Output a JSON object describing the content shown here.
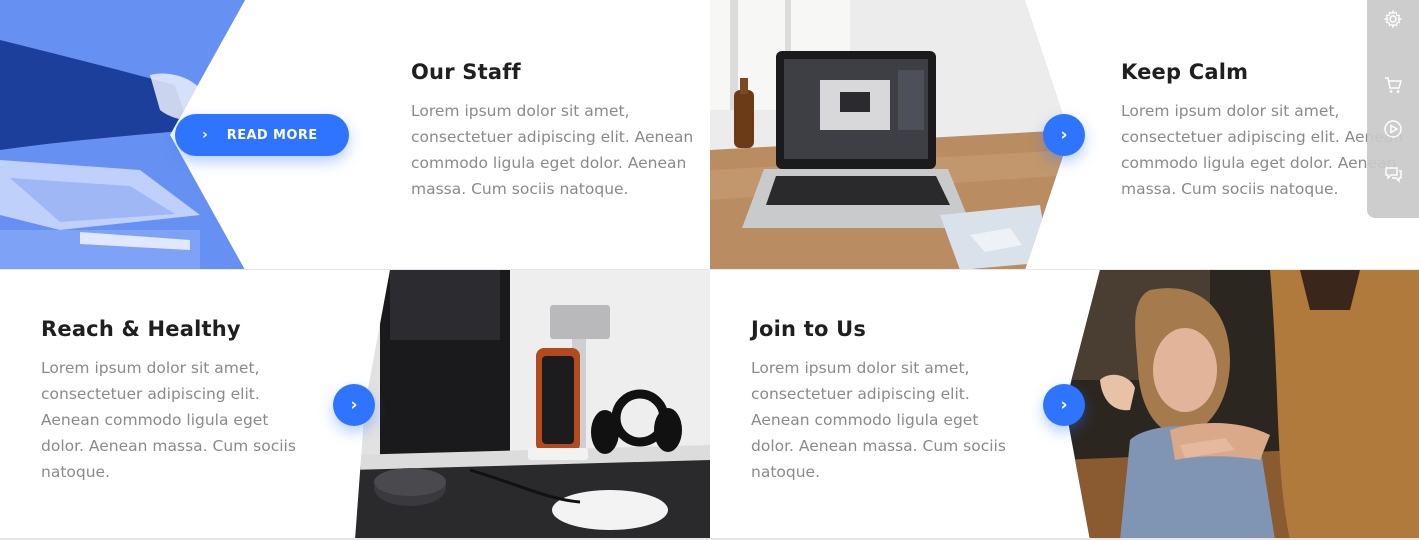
{
  "cards": [
    {
      "title": "Our Staff",
      "description": "Lorem ipsum dolor sit amet, consectetuer adipiscing elit. Aenean commodo ligula eget dolor. Aenean massa. Cum sociis natoque.",
      "button_label": "READ MORE",
      "image": "business-laptop-photo"
    },
    {
      "title": "Keep Calm",
      "description": "Lorem ipsum dolor sit amet, consectetuer adipiscing elit. Aenean commodo ligula eget dolor. Aenean massa. Cum sociis natoque.",
      "image": "laptop-desk-photo"
    },
    {
      "title": "Reach & Healthy",
      "description": "Lorem ipsum dolor sit amet, consectetuer adipiscing elit. Aenean commodo ligula eget dolor. Aenean massa. Cum sociis natoque.",
      "image": "desk-phone-headphones-photo"
    },
    {
      "title": "Join to Us",
      "description": "Lorem ipsum dolor sit amet, consectetuer adipiscing elit. Aenean commodo ligula eget dolor. Aenean massa. Cum sociis natoque.",
      "image": "people-meeting-photo"
    }
  ],
  "side_toolbar": {
    "icons": [
      "gear-icon",
      "cart-icon",
      "play-icon",
      "chat-icon"
    ]
  },
  "colors": {
    "accent": "#2f74ff",
    "title": "#1f1f1f",
    "text": "#8a8a8a"
  }
}
